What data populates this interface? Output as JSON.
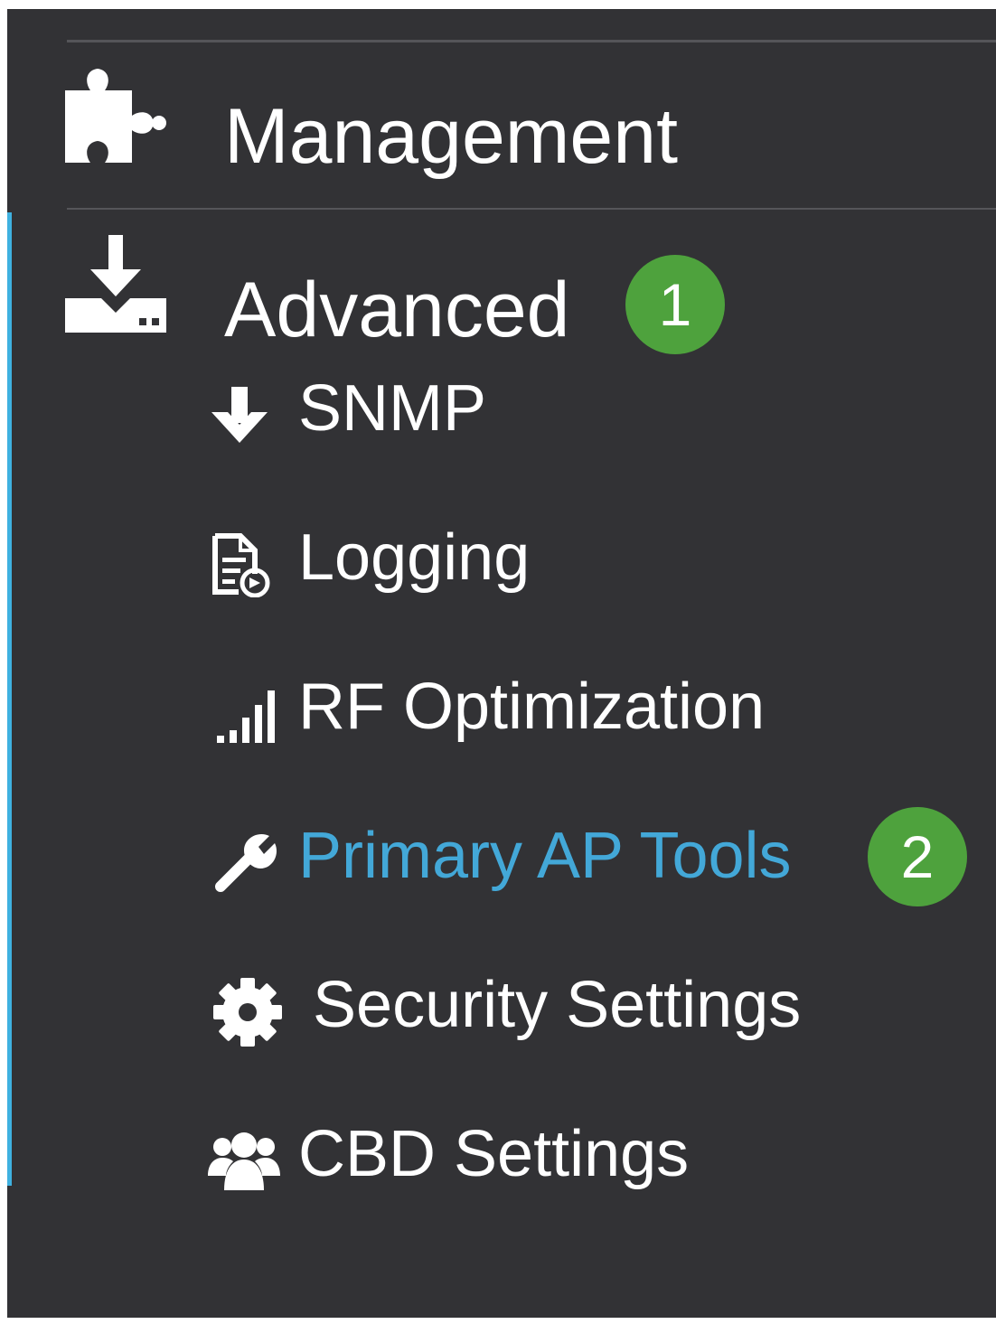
{
  "sidebar": {
    "management": {
      "label": "Management",
      "icon": "puzzle-icon"
    },
    "advanced": {
      "label": "Advanced",
      "icon": "download-tray-icon",
      "badge": "1",
      "items": [
        {
          "label": "SNMP",
          "icon": "arrow-down-icon"
        },
        {
          "label": "Logging",
          "icon": "log-file-icon"
        },
        {
          "label": "RF Optimization",
          "icon": "signal-bars-icon"
        },
        {
          "label": "Primary AP Tools",
          "icon": "wrench-icon",
          "badge": "2",
          "active": true
        },
        {
          "label": "Security Settings",
          "icon": "gear-icon"
        },
        {
          "label": "CBD Settings",
          "icon": "users-icon"
        }
      ]
    }
  },
  "colors": {
    "panel_bg": "#323235",
    "active_text": "#43a8d8",
    "active_bar": "#3fb1e0",
    "badge": "#4ea23d"
  }
}
